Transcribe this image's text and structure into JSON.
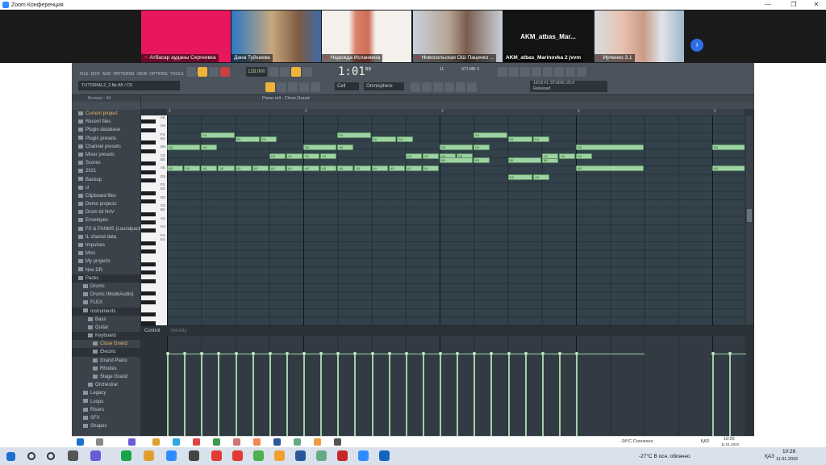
{
  "zoom": {
    "title": "Zoom Конференция",
    "window_controls": [
      "—",
      "❐",
      "✕"
    ],
    "participants": [
      {
        "name": "Атбасар ауданы Сергеевка"
      },
      {
        "name": "Дана Туйкаева"
      },
      {
        "name": "Надежда Исланкина"
      },
      {
        "name": "Новосельская ОШ Паценко ..."
      },
      {
        "name": "AKM_atbas_Marinovka 2 jvvm",
        "title": "AKM_atbas_Mar..."
      },
      {
        "name": "Ирченко 3.1"
      }
    ],
    "next_label": "›"
  },
  "fl": {
    "menu": [
      "FILE",
      "EDIT",
      "ADD",
      "PATTERNS",
      "VIEW",
      "OPTIONS",
      "TOOLS",
      "HELP"
    ],
    "file_name": "TUTORIAL2_2.flp",
    "file_meta": "A5 / C5",
    "tempo": "128.000",
    "time_main": "1:01",
    "time_sub": "00",
    "pattern": "Cell",
    "plugin": "Omnisphere",
    "news": [
      "12/15 FL STUDIO 20.9",
      "Released"
    ],
    "cpu": "11",
    "mem": "671 MB",
    "voices": "0"
  },
  "browser": {
    "header": "Browser · All",
    "items": [
      {
        "label": "Current project",
        "cls": "hl"
      },
      {
        "label": "Recent files",
        "cls": ""
      },
      {
        "label": "Plugin database",
        "cls": ""
      },
      {
        "label": "Plugin presets",
        "cls": ""
      },
      {
        "label": "Channel presets",
        "cls": ""
      },
      {
        "label": "Mixer presets",
        "cls": ""
      },
      {
        "label": "Scores",
        "cls": ""
      },
      {
        "label": "2021",
        "cls": ""
      },
      {
        "label": "Backup",
        "cls": ""
      },
      {
        "label": "cl",
        "cls": ""
      },
      {
        "label": "Clipboard files",
        "cls": ""
      },
      {
        "label": "Demo projects",
        "cls": ""
      },
      {
        "label": "Drum kit NoV",
        "cls": ""
      },
      {
        "label": "Envelopes",
        "cls": ""
      },
      {
        "label": "FX & FANMS (Loundpack 1)",
        "cls": ""
      },
      {
        "label": "IL shared data",
        "cls": ""
      },
      {
        "label": "Impulses",
        "cls": ""
      },
      {
        "label": "Misc",
        "cls": ""
      },
      {
        "label": "My projects",
        "cls": ""
      },
      {
        "label": "Nov DR",
        "cls": ""
      },
      {
        "label": "Packs",
        "cls": "sel"
      },
      {
        "label": "Drums",
        "cls": "l1"
      },
      {
        "label": "Drums (ModeAudio)",
        "cls": "l1"
      },
      {
        "label": "FLEX",
        "cls": "l1"
      },
      {
        "label": "Instruments",
        "cls": "l1 sel"
      },
      {
        "label": "Bass",
        "cls": "l2"
      },
      {
        "label": "Guitar",
        "cls": "l2"
      },
      {
        "label": "Keyboard",
        "cls": "l2 sel"
      },
      {
        "label": "Close Grand",
        "cls": "l3 hl"
      },
      {
        "label": "Electric",
        "cls": "l3 sel"
      },
      {
        "label": "Grand Piano",
        "cls": "l3"
      },
      {
        "label": "Rhodes",
        "cls": "l3"
      },
      {
        "label": "Stage Grand",
        "cls": "l3"
      },
      {
        "label": "Orchestral",
        "cls": "l2"
      },
      {
        "label": "Legacy",
        "cls": "l1"
      },
      {
        "label": "Loops",
        "cls": "l1"
      },
      {
        "label": "Risers",
        "cls": "l1"
      },
      {
        "label": "SFX",
        "cls": "l1"
      },
      {
        "label": "Shapes",
        "cls": "l1"
      }
    ]
  },
  "piano_roll": {
    "title": "Piano roll - Close Grand",
    "bars": [
      "1",
      "2",
      "3",
      "4",
      "5"
    ],
    "key_labels": [
      "A6",
      "G6",
      "F6",
      "E6",
      "D6",
      "C6",
      "B5",
      "A5",
      "G5",
      "F5",
      "E5",
      "D5",
      "C5",
      "B4",
      "A4",
      "G4",
      "F4",
      "E4"
    ],
    "control_label": "Control",
    "control_target": "Velocity",
    "notes": [
      {
        "n": "A5",
        "s": 0,
        "d": 0.5
      },
      {
        "n": "A5",
        "s": 0.5,
        "d": 0.5
      },
      {
        "n": "A5",
        "s": 1,
        "d": 0.5
      },
      {
        "n": "A5",
        "s": 1.5,
        "d": 0.5
      },
      {
        "n": "A5",
        "s": 2,
        "d": 0.5
      },
      {
        "n": "A5",
        "s": 2.5,
        "d": 0.5
      },
      {
        "n": "A5",
        "s": 3,
        "d": 0.5
      },
      {
        "n": "A5",
        "s": 3.5,
        "d": 0.5
      },
      {
        "n": "D6",
        "s": 0,
        "d": 1
      },
      {
        "n": "D6",
        "s": 1,
        "d": 0.5
      },
      {
        "n": "F6",
        "s": 1,
        "d": 1
      },
      {
        "n": "E6",
        "s": 2,
        "d": 0.75
      },
      {
        "n": "E6",
        "s": 2.75,
        "d": 0.5
      },
      {
        "n": "C6",
        "s": 3,
        "d": 0.5
      },
      {
        "n": "C6",
        "s": 3.5,
        "d": 0.5
      },
      {
        "n": "C6",
        "s": 4,
        "d": 0.5
      },
      {
        "n": "C6",
        "s": 4.5,
        "d": 0.5
      },
      {
        "n": "A5",
        "s": 4,
        "d": 0.5
      },
      {
        "n": "A5",
        "s": 4.5,
        "d": 0.5
      },
      {
        "n": "A5",
        "s": 5,
        "d": 0.5
      },
      {
        "n": "A5",
        "s": 5.5,
        "d": 0.5
      },
      {
        "n": "A5",
        "s": 6,
        "d": 0.5
      },
      {
        "n": "A5",
        "s": 6.5,
        "d": 0.5
      },
      {
        "n": "A5",
        "s": 7,
        "d": 0.5
      },
      {
        "n": "A5",
        "s": 7.5,
        "d": 0.5
      },
      {
        "n": "D6",
        "s": 4,
        "d": 1
      },
      {
        "n": "D6",
        "s": 5,
        "d": 0.5
      },
      {
        "n": "F6",
        "s": 5,
        "d": 1
      },
      {
        "n": "E6",
        "s": 6,
        "d": 0.75
      },
      {
        "n": "E6",
        "s": 6.75,
        "d": 0.5
      },
      {
        "n": "C6",
        "s": 7,
        "d": 0.5
      },
      {
        "n": "C6",
        "s": 7.5,
        "d": 0.5
      },
      {
        "n": "C6",
        "s": 8,
        "d": 0.5
      },
      {
        "n": "C6",
        "s": 8.5,
        "d": 0.5
      },
      {
        "n": "D6",
        "s": 8,
        "d": 1
      },
      {
        "n": "D6",
        "s": 9,
        "d": 0.5
      },
      {
        "n": "B5",
        "s": 8,
        "d": 1
      },
      {
        "n": "B5",
        "s": 9,
        "d": 0.5
      },
      {
        "n": "B5",
        "s": 10,
        "d": 1
      },
      {
        "n": "B5",
        "s": 11,
        "d": 0.5
      },
      {
        "n": "F6",
        "s": 9,
        "d": 1
      },
      {
        "n": "E6",
        "s": 10,
        "d": 0.75
      },
      {
        "n": "E6",
        "s": 10.75,
        "d": 0.5
      },
      {
        "n": "G5",
        "s": 10,
        "d": 0.75
      },
      {
        "n": "G5",
        "s": 10.75,
        "d": 0.5
      },
      {
        "n": "C6",
        "s": 11,
        "d": 0.5
      },
      {
        "n": "C6",
        "s": 11.5,
        "d": 0.5
      },
      {
        "n": "C6",
        "s": 12,
        "d": 0.5
      },
      {
        "n": "D6",
        "s": 12,
        "d": 2
      },
      {
        "n": "A5",
        "s": 12,
        "d": 2
      },
      {
        "n": "D6",
        "s": 16,
        "d": 1
      },
      {
        "n": "A5",
        "s": 16,
        "d": 1
      }
    ],
    "velocities": [
      0,
      0.5,
      1,
      1.5,
      2,
      2.5,
      3,
      3.5,
      4,
      4.5,
      5,
      5.5,
      6,
      6.5,
      7,
      7.5,
      8,
      8.5,
      9,
      9.5,
      10,
      10.5,
      11,
      11.5,
      12,
      16,
      16.5
    ]
  },
  "inner_taskbar": {
    "weather": "-34°C Солнечно",
    "lang": "ҚАЗ",
    "time": "10:26",
    "date": "11.01.2022"
  },
  "taskbar": {
    "weather": "-27°C В осн. облачно",
    "lang": "ҚАЗ",
    "time": "10:26",
    "date": "11.01.2022"
  }
}
